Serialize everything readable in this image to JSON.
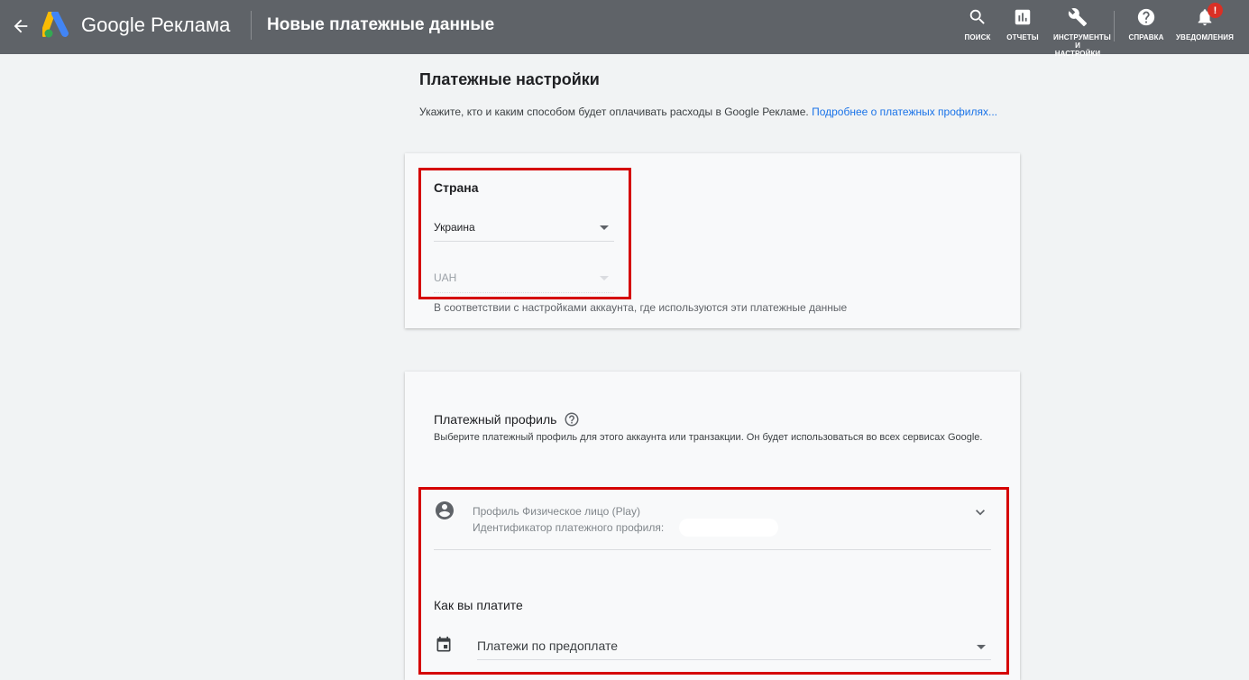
{
  "header": {
    "brand": "Google Реклама",
    "page_title": "Новые платежные данные",
    "tools": [
      {
        "label": "ПОИСК",
        "icon": "search-icon"
      },
      {
        "label": "ОТЧЕТЫ",
        "icon": "reports-icon"
      },
      {
        "label": "ИНСТРУМЕНТЫ И НАСТРОЙКИ",
        "icon": "wrench-icon"
      },
      {
        "label": "СПРАВКА",
        "icon": "help-icon"
      },
      {
        "label": "УВЕДОМЛЕНИЯ",
        "icon": "bell-icon"
      }
    ],
    "notification_badge": "!"
  },
  "main": {
    "title": "Платежные настройки",
    "description": "Укажите, кто и каким способом будет оплачивать расходы в Google Рекламе.",
    "link": "Подробнее о платежных профилях..."
  },
  "country_card": {
    "label": "Страна",
    "country_value": "Украина",
    "currency_value": "UAH",
    "hint": "В соответствии с настройками аккаунта, где используются эти платежные данные"
  },
  "profile_card": {
    "title": "Платежный профиль",
    "description": "Выберите платежный профиль для этого аккаунта или транзакции. Он будет использоваться во всех сервисах Google.",
    "profile_name": "Профиль Физическое лицо (Play)",
    "profile_id_label": "Идентификатор платежного профиля:",
    "pay_label": "Как вы платите",
    "pay_value": "Платежи по предоплате"
  },
  "colors": {
    "topbar": "#5f6368",
    "link": "#1a73e8",
    "highlight_box": "#d50000",
    "badge": "#d93025"
  }
}
